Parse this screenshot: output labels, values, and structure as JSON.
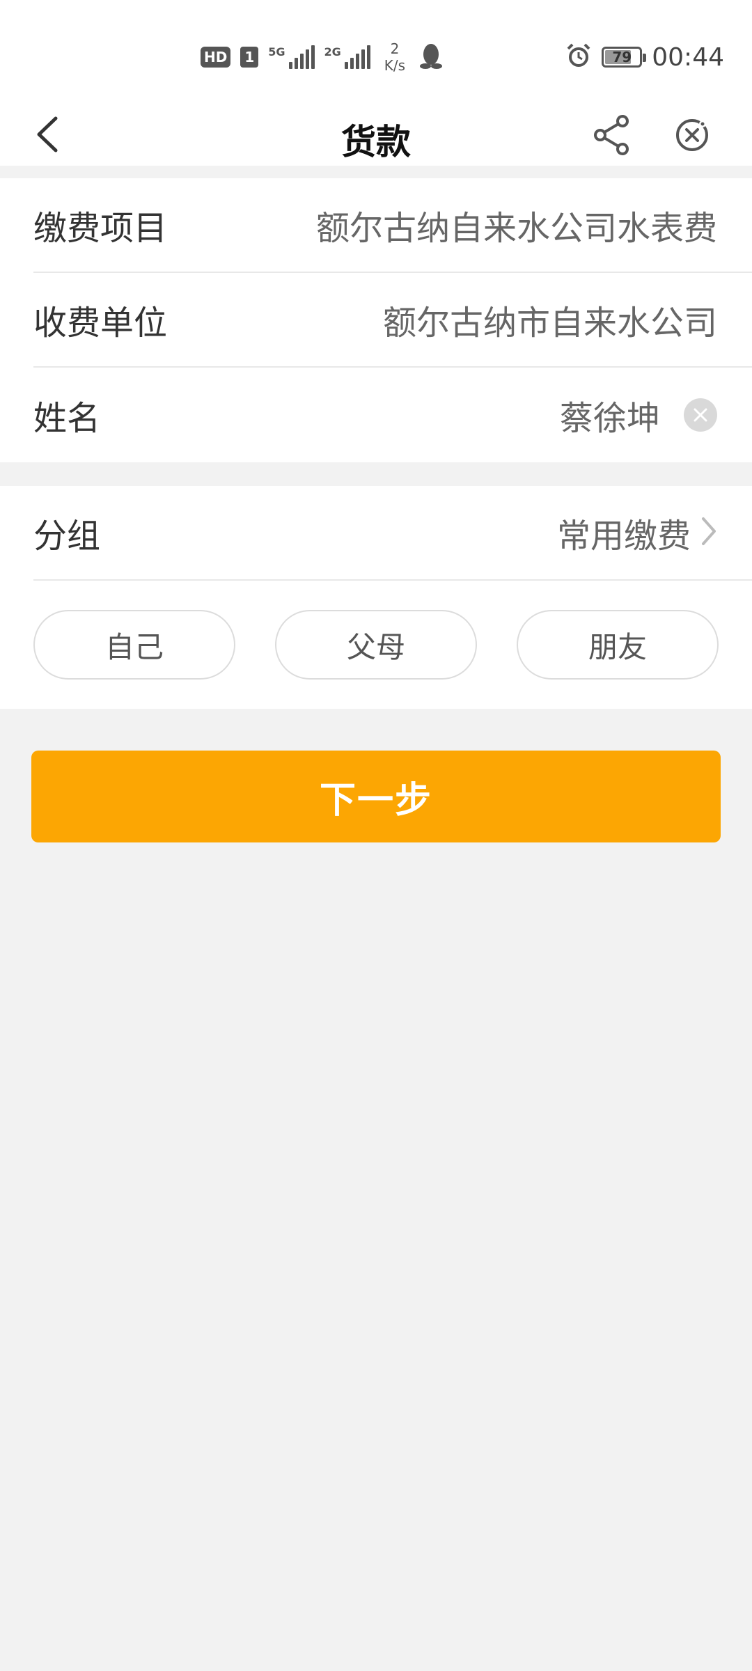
{
  "status_bar": {
    "hd": "HD",
    "sim": "1",
    "net1": "5G",
    "net2": "2G",
    "speed_value": "2",
    "speed_unit": "K/s",
    "battery": "79",
    "time": "00:44"
  },
  "nav": {
    "title": "货款"
  },
  "form": {
    "item_label": "缴费项目",
    "item_value": "额尔古纳自来水公司水表费",
    "unit_label": "收费单位",
    "unit_value": "额尔古纳市自来水公司",
    "name_label": "姓名",
    "name_value": "蔡徐坤"
  },
  "group": {
    "label": "分组",
    "value": "常用缴费",
    "options": [
      "自己",
      "父母",
      "朋友"
    ]
  },
  "next_button": "下一步",
  "colors": {
    "accent": "#fca603",
    "background": "#f2f2f2"
  }
}
